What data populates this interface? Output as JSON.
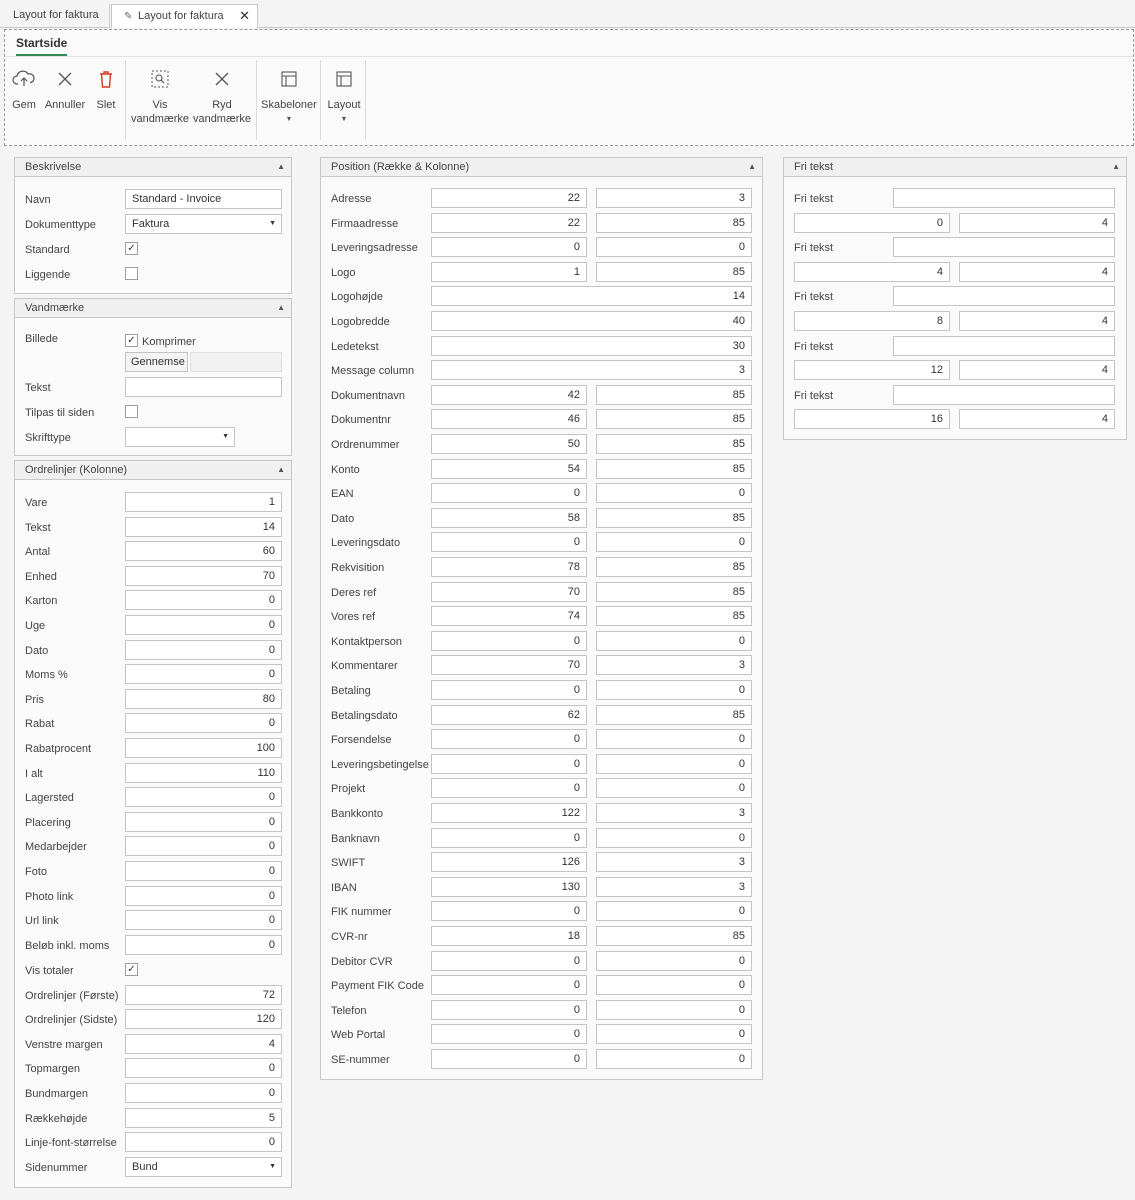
{
  "tabs": [
    {
      "label": "Layout for faktura"
    },
    {
      "label": "Layout for faktura"
    }
  ],
  "ribbon": {
    "tab": "Startside",
    "buttons": {
      "gem": "Gem",
      "annuller": "Annuller",
      "slet": "Slet",
      "vis1": "Vis",
      "vis2": "vandmærke",
      "ryd1": "Ryd",
      "ryd2": "vandmærke",
      "skabeloner": "Skabeloner",
      "layout": "Layout"
    }
  },
  "beskrivelse": {
    "title": "Beskrivelse",
    "navn_label": "Navn",
    "navn_value": "Standard - Invoice",
    "doktype_label": "Dokumenttype",
    "doktype_value": "Faktura",
    "standard_label": "Standard",
    "standard_checked": true,
    "liggende_label": "Liggende",
    "liggende_checked": false
  },
  "vandmaerke": {
    "title": "Vandmærke",
    "billede_label": "Billede",
    "komprimer_label": "Komprimer",
    "gennemse_label": "Gennemse",
    "tekst_label": "Tekst",
    "tilpas_label": "Tilpas til siden",
    "skrifttype_label": "Skrifttype"
  },
  "ordrelinjer": {
    "title": "Ordrelinjer (Kolonne)",
    "rows": [
      {
        "label": "Vare",
        "value": "1"
      },
      {
        "label": "Tekst",
        "value": "14"
      },
      {
        "label": "Antal",
        "value": "60"
      },
      {
        "label": "Enhed",
        "value": "70"
      },
      {
        "label": "Karton",
        "value": "0"
      },
      {
        "label": "Uge",
        "value": "0"
      },
      {
        "label": "Dato",
        "value": "0"
      },
      {
        "label": "Moms %",
        "value": "0"
      },
      {
        "label": "Pris",
        "value": "80"
      },
      {
        "label": "Rabat",
        "value": "0"
      },
      {
        "label": "Rabatprocent",
        "value": "100"
      },
      {
        "label": "I alt",
        "value": "110"
      },
      {
        "label": "Lagersted",
        "value": "0"
      },
      {
        "label": "Placering",
        "value": "0"
      },
      {
        "label": "Medarbejder",
        "value": "0"
      },
      {
        "label": "Foto",
        "value": "0"
      },
      {
        "label": "Photo link",
        "value": "0"
      },
      {
        "label": "Url link",
        "value": "0"
      },
      {
        "label": "Beløb inkl. moms",
        "value": "0"
      }
    ],
    "vis_totaler_label": "Vis totaler",
    "vis_totaler_checked": true,
    "rows2": [
      {
        "label": "Ordrelinjer (Første)",
        "value": "72"
      },
      {
        "label": "Ordrelinjer (Sidste)",
        "value": "120"
      },
      {
        "label": "Venstre margen",
        "value": "4"
      },
      {
        "label": "Topmargen",
        "value": "0"
      },
      {
        "label": "Bundmargen",
        "value": "0"
      },
      {
        "label": "Rækkehøjde",
        "value": "5"
      },
      {
        "label": "Linje-font-størrelse",
        "value": "0"
      }
    ],
    "sidenummer_label": "Sidenummer",
    "sidenummer_value": "Bund"
  },
  "position": {
    "title": "Position (Række & Kolonne)",
    "rows": [
      {
        "label": "Adresse",
        "row": "22",
        "col": "3"
      },
      {
        "label": "Firmaadresse",
        "row": "22",
        "col": "85"
      },
      {
        "label": "Leveringsadresse",
        "row": "0",
        "col": "0"
      },
      {
        "label": "Logo",
        "row": "1",
        "col": "85"
      },
      {
        "label": "Logohøjde",
        "single": "14"
      },
      {
        "label": "Logobredde",
        "single": "40"
      },
      {
        "label": "Ledetekst",
        "single": "30"
      },
      {
        "label": "Message column",
        "single": "3"
      },
      {
        "label": "Dokumentnavn",
        "row": "42",
        "col": "85"
      },
      {
        "label": "Dokumentnr",
        "row": "46",
        "col": "85"
      },
      {
        "label": "Ordrenummer",
        "row": "50",
        "col": "85"
      },
      {
        "label": "Konto",
        "row": "54",
        "col": "85"
      },
      {
        "label": "EAN",
        "row": "0",
        "col": "0"
      },
      {
        "label": "Dato",
        "row": "58",
        "col": "85"
      },
      {
        "label": "Leveringsdato",
        "row": "0",
        "col": "0"
      },
      {
        "label": "Rekvisition",
        "row": "78",
        "col": "85"
      },
      {
        "label": "Deres ref",
        "row": "70",
        "col": "85"
      },
      {
        "label": "Vores ref",
        "row": "74",
        "col": "85"
      },
      {
        "label": "Kontaktperson",
        "row": "0",
        "col": "0"
      },
      {
        "label": "Kommentarer",
        "row": "70",
        "col": "3"
      },
      {
        "label": "Betaling",
        "row": "0",
        "col": "0"
      },
      {
        "label": "Betalingsdato",
        "row": "62",
        "col": "85"
      },
      {
        "label": "Forsendelse",
        "row": "0",
        "col": "0"
      },
      {
        "label": "Leveringsbetingelse",
        "row": "0",
        "col": "0"
      },
      {
        "label": "Projekt",
        "row": "0",
        "col": "0"
      },
      {
        "label": "Bankkonto",
        "row": "122",
        "col": "3"
      },
      {
        "label": "Banknavn",
        "row": "0",
        "col": "0"
      },
      {
        "label": "SWIFT",
        "row": "126",
        "col": "3"
      },
      {
        "label": "IBAN",
        "row": "130",
        "col": "3"
      },
      {
        "label": "FIK nummer",
        "row": "0",
        "col": "0"
      },
      {
        "label": "CVR-nr",
        "row": "18",
        "col": "85"
      },
      {
        "label": "Debitor CVR",
        "row": "0",
        "col": "0"
      },
      {
        "label": "Payment FIK Code",
        "row": "0",
        "col": "0"
      },
      {
        "label": "Telefon",
        "row": "0",
        "col": "0"
      },
      {
        "label": "Web Portal",
        "row": "0",
        "col": "0"
      },
      {
        "label": "SE-nummer",
        "row": "0",
        "col": "0"
      }
    ]
  },
  "fritekst": {
    "title": "Fri tekst",
    "items": [
      {
        "label": "Fri tekst",
        "text": "",
        "row": "0",
        "col": "4"
      },
      {
        "label": "Fri tekst",
        "text": "",
        "row": "4",
        "col": "4"
      },
      {
        "label": "Fri tekst",
        "text": "",
        "row": "8",
        "col": "4"
      },
      {
        "label": "Fri tekst",
        "text": "",
        "row": "12",
        "col": "4"
      },
      {
        "label": "Fri tekst",
        "text": "",
        "row": "16",
        "col": "4"
      }
    ]
  },
  "icons": {
    "gem": "cloud-upload-icon",
    "annuller": "close-icon",
    "slet": "trash-icon",
    "vis": "watermark-view-icon",
    "ryd": "close-icon",
    "skabeloner": "template-icon",
    "layout": "layout-icon",
    "tab_pin": "edit-icon",
    "tab_close": "close-icon",
    "collapse": "collapse-up-icon"
  },
  "colors": {
    "delete_icon": "#d9342b",
    "active_tab_underline": "#2e8b57"
  }
}
